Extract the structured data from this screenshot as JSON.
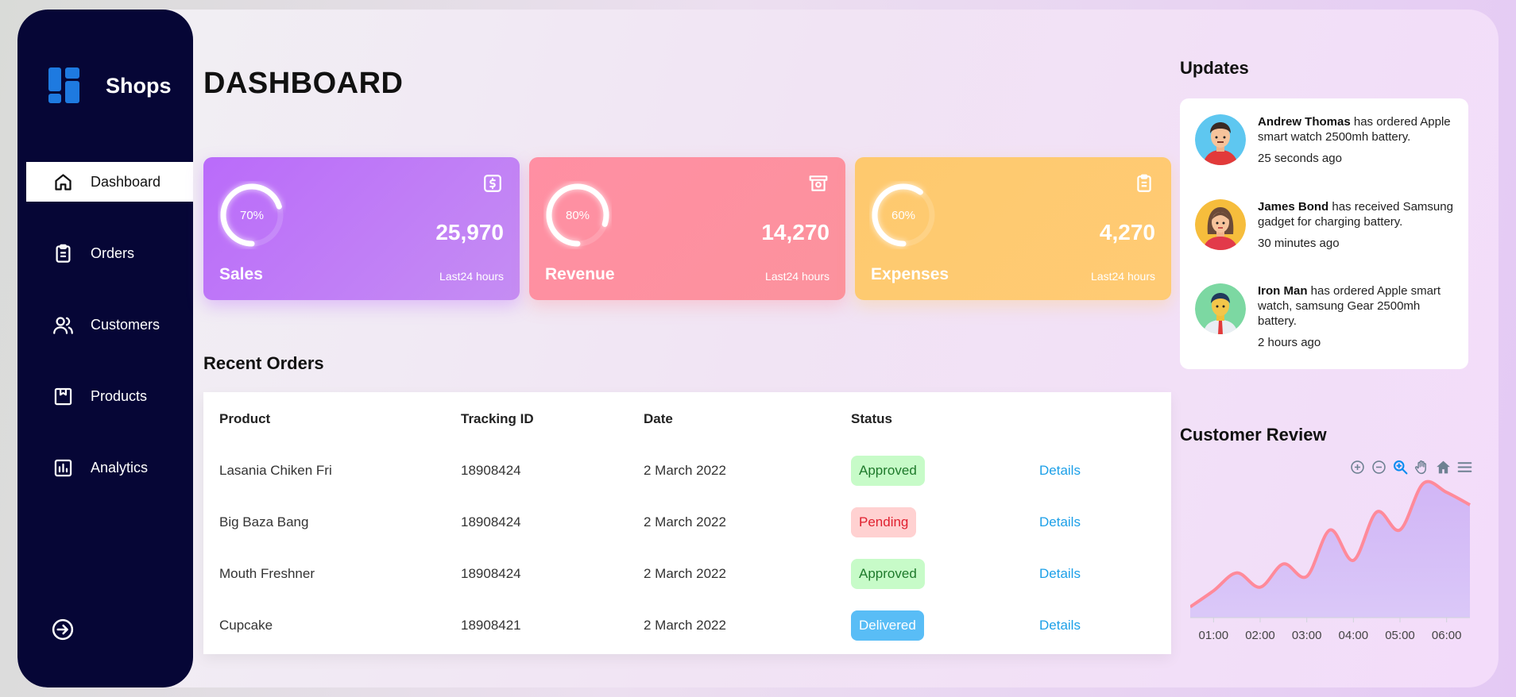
{
  "sidebar": {
    "brand": "Shops",
    "items": [
      {
        "label": "Dashboard",
        "icon": "home-icon",
        "active": true
      },
      {
        "label": "Orders",
        "icon": "clipboard-icon",
        "active": false
      },
      {
        "label": "Customers",
        "icon": "users-icon",
        "active": false
      },
      {
        "label": "Products",
        "icon": "package-icon",
        "active": false
      },
      {
        "label": "Analytics",
        "icon": "bar-chart-icon",
        "active": false
      }
    ],
    "logout_icon": "logout-icon"
  },
  "header": {
    "title": "DASHBOARD"
  },
  "cards": [
    {
      "title": "Sales",
      "percent": 70,
      "percent_label": "70%",
      "value": "25,970",
      "sub": "Last24 hours",
      "icon": "dollar-icon",
      "color": "#bb67ff"
    },
    {
      "title": "Revenue",
      "percent": 80,
      "percent_label": "80%",
      "value": "14,270",
      "sub": "Last24 hours",
      "icon": "money-icon",
      "color": "#fc929d"
    },
    {
      "title": "Expenses",
      "percent": 60,
      "percent_label": "60%",
      "value": "4,270",
      "sub": "Last24 hours",
      "icon": "clipboard-icon",
      "color": "#ffca71"
    }
  ],
  "recent_orders": {
    "title": "Recent Orders",
    "columns": [
      "Product",
      "Tracking ID",
      "Date",
      "Status"
    ],
    "rows": [
      {
        "product": "Lasania Chiken Fri",
        "tracking": "18908424",
        "date": "2 March 2022",
        "status": "Approved",
        "link": "Details"
      },
      {
        "product": "Big Baza Bang",
        "tracking": "18908424",
        "date": "2 March 2022",
        "status": "Pending",
        "link": "Details"
      },
      {
        "product": "Mouth Freshner",
        "tracking": "18908424",
        "date": "2 March 2022",
        "status": "Approved",
        "link": "Details"
      },
      {
        "product": "Cupcake",
        "tracking": "18908421",
        "date": "2 March 2022",
        "status": "Delivered",
        "link": "Details"
      }
    ]
  },
  "updates": {
    "title": "Updates",
    "items": [
      {
        "name": "Andrew Thomas",
        "text": " has ordered Apple smart watch 2500mh battery.",
        "time": "25 seconds ago"
      },
      {
        "name": "James Bond",
        "text": " has received Samsung gadget for charging battery.",
        "time": "30 minutes ago"
      },
      {
        "name": "Iron Man",
        "text": " has ordered Apple smart watch, samsung Gear 2500mh battery.",
        "time": "2 hours ago"
      }
    ]
  },
  "customer_review": {
    "title": "Customer Review",
    "toolbar": [
      "zoom-in-icon",
      "zoom-out-icon",
      "search-zoom-icon",
      "pan-hand-icon",
      "home-reset-icon",
      "menu-icon"
    ]
  },
  "chart_data": {
    "type": "area",
    "title": "",
    "x": [
      "00:30",
      "01:00",
      "01:30",
      "02:00",
      "02:30",
      "03:00",
      "03:30",
      "04:00",
      "04:30",
      "05:00",
      "05:30",
      "06:00",
      "06:30"
    ],
    "tick_labels": [
      "01:00",
      "02:00",
      "03:00",
      "04:00",
      "05:00",
      "06:00"
    ],
    "series": [
      {
        "values": [
          12,
          30,
          50,
          34,
          60,
          46,
          98,
          64,
          118,
          98,
          150,
          140,
          126
        ]
      }
    ],
    "ylim": [
      0,
      165
    ],
    "grid": false,
    "legend": "none"
  }
}
